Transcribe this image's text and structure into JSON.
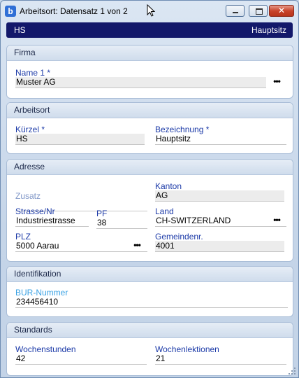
{
  "window": {
    "app_icon": "b",
    "title": "Arbeitsort: Datensatz 1 von 2",
    "min_icon": "minimize-icon",
    "max_icon": "maximize-icon",
    "close_icon": "close-icon",
    "close_glyph": "✕"
  },
  "record_bar": {
    "left": "HS",
    "right": "Hauptsitz"
  },
  "lookup_glyph": "•••",
  "sections": {
    "firma": {
      "title": "Firma",
      "name1_label": "Name 1 *",
      "name1_value": "Muster AG"
    },
    "arbeitsort": {
      "title": "Arbeitsort",
      "kuerzel_label": "Kürzel *",
      "kuerzel_value": "HS",
      "bezeichnung_label": "Bezeichnung *",
      "bezeichnung_value": "Hauptsitz"
    },
    "adresse": {
      "title": "Adresse",
      "zusatz_label": "Zusatz",
      "zusatz_value": "",
      "kanton_label": "Kanton",
      "kanton_value": "AG",
      "strasse_label": "Strasse/Nr",
      "strasse_value": "Industriestrasse",
      "pf_label": "PF",
      "pf_value": "38",
      "land_label": "Land",
      "land_value": "CH-SWITZERLAND",
      "plz_label": "PLZ",
      "plz_value": "5000 Aarau",
      "gemeinde_label": "Gemeindenr.",
      "gemeinde_value": "4001"
    },
    "identifikation": {
      "title": "Identifikation",
      "bur_label": "BUR-Nummer",
      "bur_value": "234456410"
    },
    "standards": {
      "title": "Standards",
      "wochenstunden_label": "Wochenstunden",
      "wochenstunden_value": "42",
      "wochenlektionen_label": "Wochenlektionen",
      "wochenlektionen_value": "21"
    }
  }
}
